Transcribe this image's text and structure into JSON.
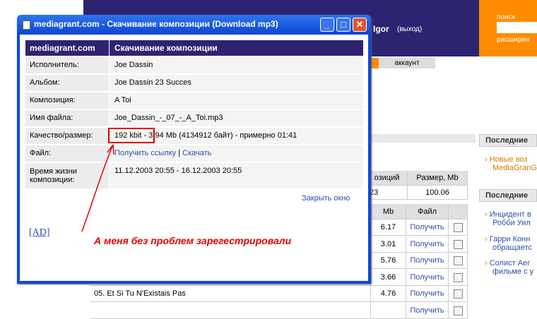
{
  "site": {
    "user_name": "Igor",
    "logout": "(выход)",
    "search_label": "поиск",
    "extended_label": "расширен",
    "tab_account": "аккаунт"
  },
  "sidebar": {
    "box1_title": "Последние",
    "box1_items": [
      "Новые воз",
      "MediaGranG"
    ],
    "box2_title": "Последние",
    "box2_items": [
      "Инцидент в",
      "Робби Уил",
      "Гарри Конн",
      "обращаетс",
      "Солист Aer",
      "фильме с у"
    ]
  },
  "bg_table": {
    "header_compositions": "озиций",
    "header_size": "Размер, Mb",
    "summary_count": "23",
    "summary_size": "100.06",
    "col_mb": "Mb",
    "col_file": "Файл",
    "rows": [
      {
        "title": "",
        "mb": "6.17",
        "action": "Получить"
      },
      {
        "title": "",
        "mb": "3.01",
        "action": "Получить"
      },
      {
        "title": "",
        "mb": "5.76",
        "action": "Получить"
      },
      {
        "title": "",
        "mb": "3.66",
        "action": "Получить"
      },
      {
        "title": "05. Et Si Tu N'Existais Pas",
        "mb": "4.76",
        "action": "Получить"
      },
      {
        "title": "",
        "mb": "",
        "action": "Получить"
      }
    ]
  },
  "popup": {
    "title": "mediagrant.com - Скачивание композиции (Download mp3)",
    "head_left": "mediagrant.com",
    "head_right": "Скачивание композиции",
    "rows": [
      {
        "label": "Исполнитель:",
        "value": "Joe Dassin"
      },
      {
        "label": "Альбом:",
        "value": "Joe Dassin 23 Succes"
      },
      {
        "label": "Композиция:",
        "value": "A Toi"
      },
      {
        "label": "Имя файла:",
        "value": "Joe_Dassin_-_07_-_A_Toi.mp3"
      },
      {
        "label": "Качество/размер:",
        "value": "192 kbit - 3.94 Mb (4134912 байт) - примерно 01:41"
      },
      {
        "label": "Файл:",
        "link1": "Получить ссылку",
        "sep": "|",
        "link2": "Скачать"
      },
      {
        "label": "Время жизни композиции:",
        "value": "11.12.2003 20:55 - 16.12.2003 20:55"
      }
    ],
    "close_window": "Закрыть окно",
    "ad": "[AD]"
  },
  "annotation": "А меня без проблем зарегестрировали",
  "colors": {
    "accent_navy": "#2c2470",
    "accent_orange": "#ff8c00",
    "annotation_red": "#e00000",
    "window_blue": "#0b4ad6"
  }
}
